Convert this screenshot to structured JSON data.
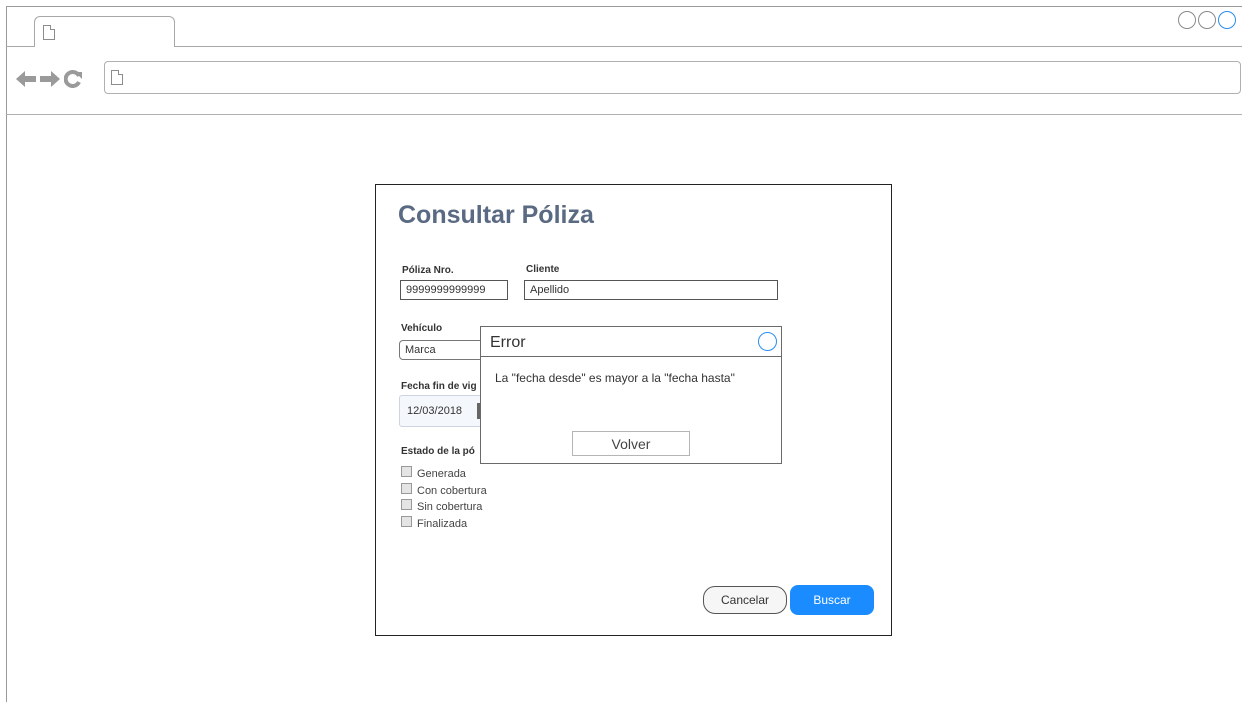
{
  "browser": {
    "tab_icon": "page-icon",
    "address_icon": "page-icon",
    "nav_icons": [
      "back-arrow-icon",
      "forward-arrow-icon",
      "reload-icon"
    ],
    "window_controls": [
      "circle",
      "circle",
      "circle"
    ],
    "accent_color": "#1a8cff"
  },
  "form": {
    "title": "Consultar Póliza",
    "poliza_label": "Póliza Nro.",
    "poliza_value": "9999999999999",
    "cliente_label": "Cliente",
    "cliente_value": "Apellido",
    "vehiculo_label": "Vehículo",
    "vehiculo_value": "Marca",
    "fecha_label": "Fecha fin de vig",
    "fecha_value": "12/03/2018",
    "estado_label": "Estado de la pó",
    "estado_options": [
      "Generada",
      "Con cobertura",
      "Sin cobertura",
      "Finalizada"
    ],
    "cancel_label": "Cancelar",
    "search_label": "Buscar"
  },
  "dialog": {
    "title": "Error",
    "message": "La \"fecha desde\" es mayor a la \"fecha hasta\"",
    "button_label": "Volver"
  }
}
